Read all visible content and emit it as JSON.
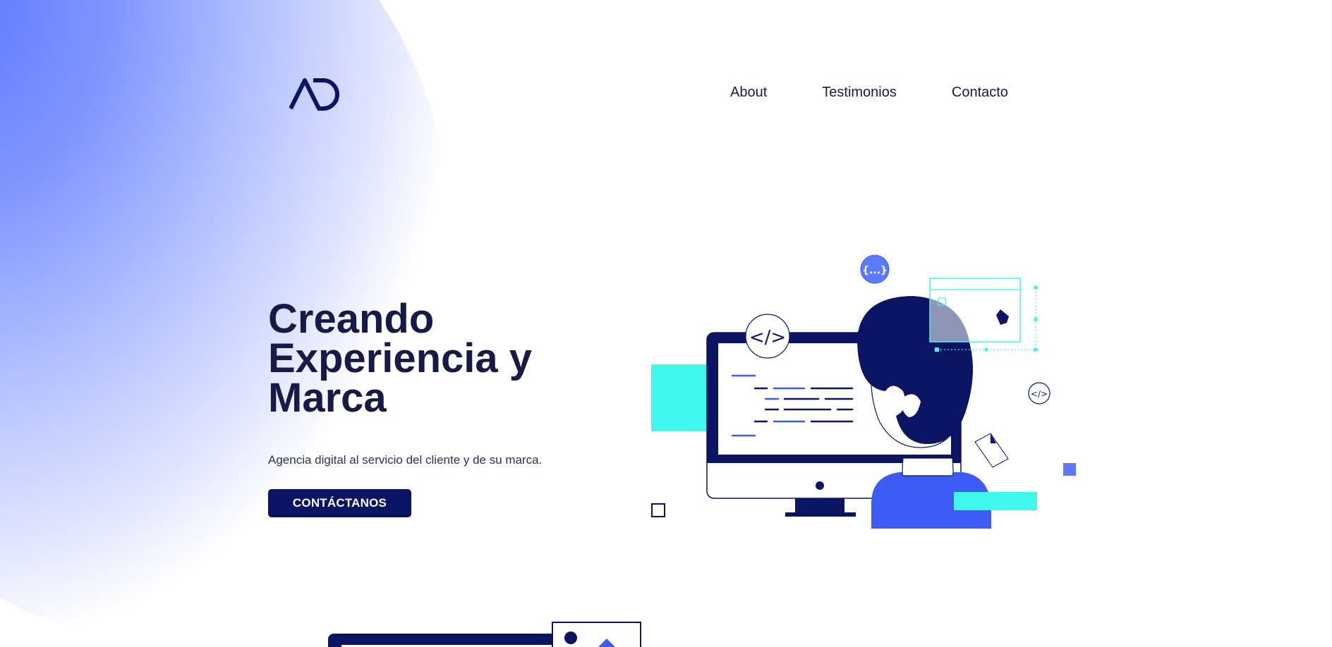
{
  "header": {
    "logo_icon": "ad-monogram-logo",
    "nav": [
      {
        "label": "About"
      },
      {
        "label": "Testimonios"
      },
      {
        "label": "Contacto"
      }
    ]
  },
  "hero": {
    "title_lines": [
      "Creando",
      "Experiencia y",
      "Marca"
    ],
    "subtitle": "Agencia digital al servicio del cliente y de su marca.",
    "cta_label": "CONTÁCTANOS"
  },
  "illustration": {
    "code_badge": "</>",
    "code_badge_small": "</>",
    "braces_badge": "{...}",
    "icons": [
      "monitor-icon",
      "developer-person-icon",
      "pen-tool-icon",
      "document-icon"
    ]
  },
  "colors": {
    "navy": "#0a1463",
    "text": "#161a46",
    "accent_blue": "#3d5cf5",
    "cyan": "#3ff7ea",
    "glow": "#5c79ff"
  }
}
